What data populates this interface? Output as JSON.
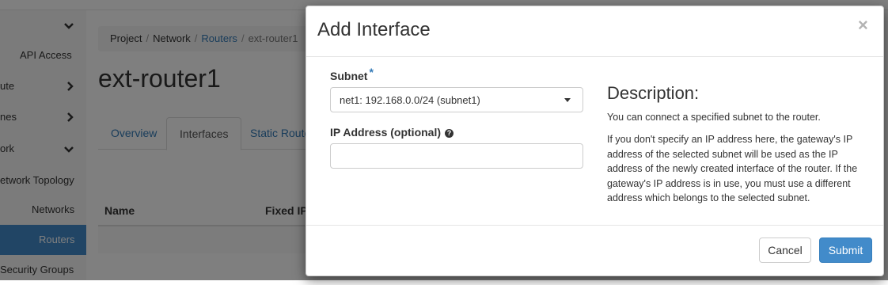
{
  "sidebar": {
    "items": [
      {
        "label": "",
        "chevron": "down"
      },
      {
        "label": "API Access",
        "chevron": ""
      },
      {
        "label": "ute",
        "chevron": "right"
      },
      {
        "label": "nes",
        "chevron": "right"
      },
      {
        "label": "ork",
        "chevron": "down"
      },
      {
        "label": "etwork Topology",
        "chevron": ""
      },
      {
        "label": "Networks",
        "chevron": ""
      },
      {
        "label": "Routers",
        "chevron": "",
        "active": true
      },
      {
        "label": "Security Groups",
        "chevron": ""
      }
    ]
  },
  "breadcrumb": {
    "project": "Project",
    "network": "Network",
    "routers": "Routers",
    "current": "ext-router1"
  },
  "page_title": "ext-router1",
  "tabs": [
    "Overview",
    "Interfaces",
    "Static Routes"
  ],
  "table": {
    "columns": [
      "Name",
      "Fixed IPs"
    ]
  },
  "modal": {
    "title": "Add Interface",
    "close_symbol": "×",
    "subnet": {
      "label": "Subnet",
      "required_mark": "*",
      "selected": "net1: 192.168.0.0/24 (subnet1)"
    },
    "ip_address": {
      "label": "IP Address (optional)",
      "help_symbol": "?",
      "value": "",
      "placeholder": ""
    },
    "description": {
      "title": "Description:",
      "p1": "You can connect a specified subnet to the router.",
      "p2": "If you don't specify an IP address here, the gateway's IP address of the selected subnet will be used as the IP address of the newly created interface of the router. If the gateway's IP address is in use, you must use a different address which belongs to the selected subnet."
    },
    "buttons": {
      "cancel": "Cancel",
      "submit": "Submit"
    }
  },
  "colors": {
    "accent": "#428bca",
    "link": "#337ab7",
    "overlay": "rgba(0,0,0,0.5)"
  }
}
